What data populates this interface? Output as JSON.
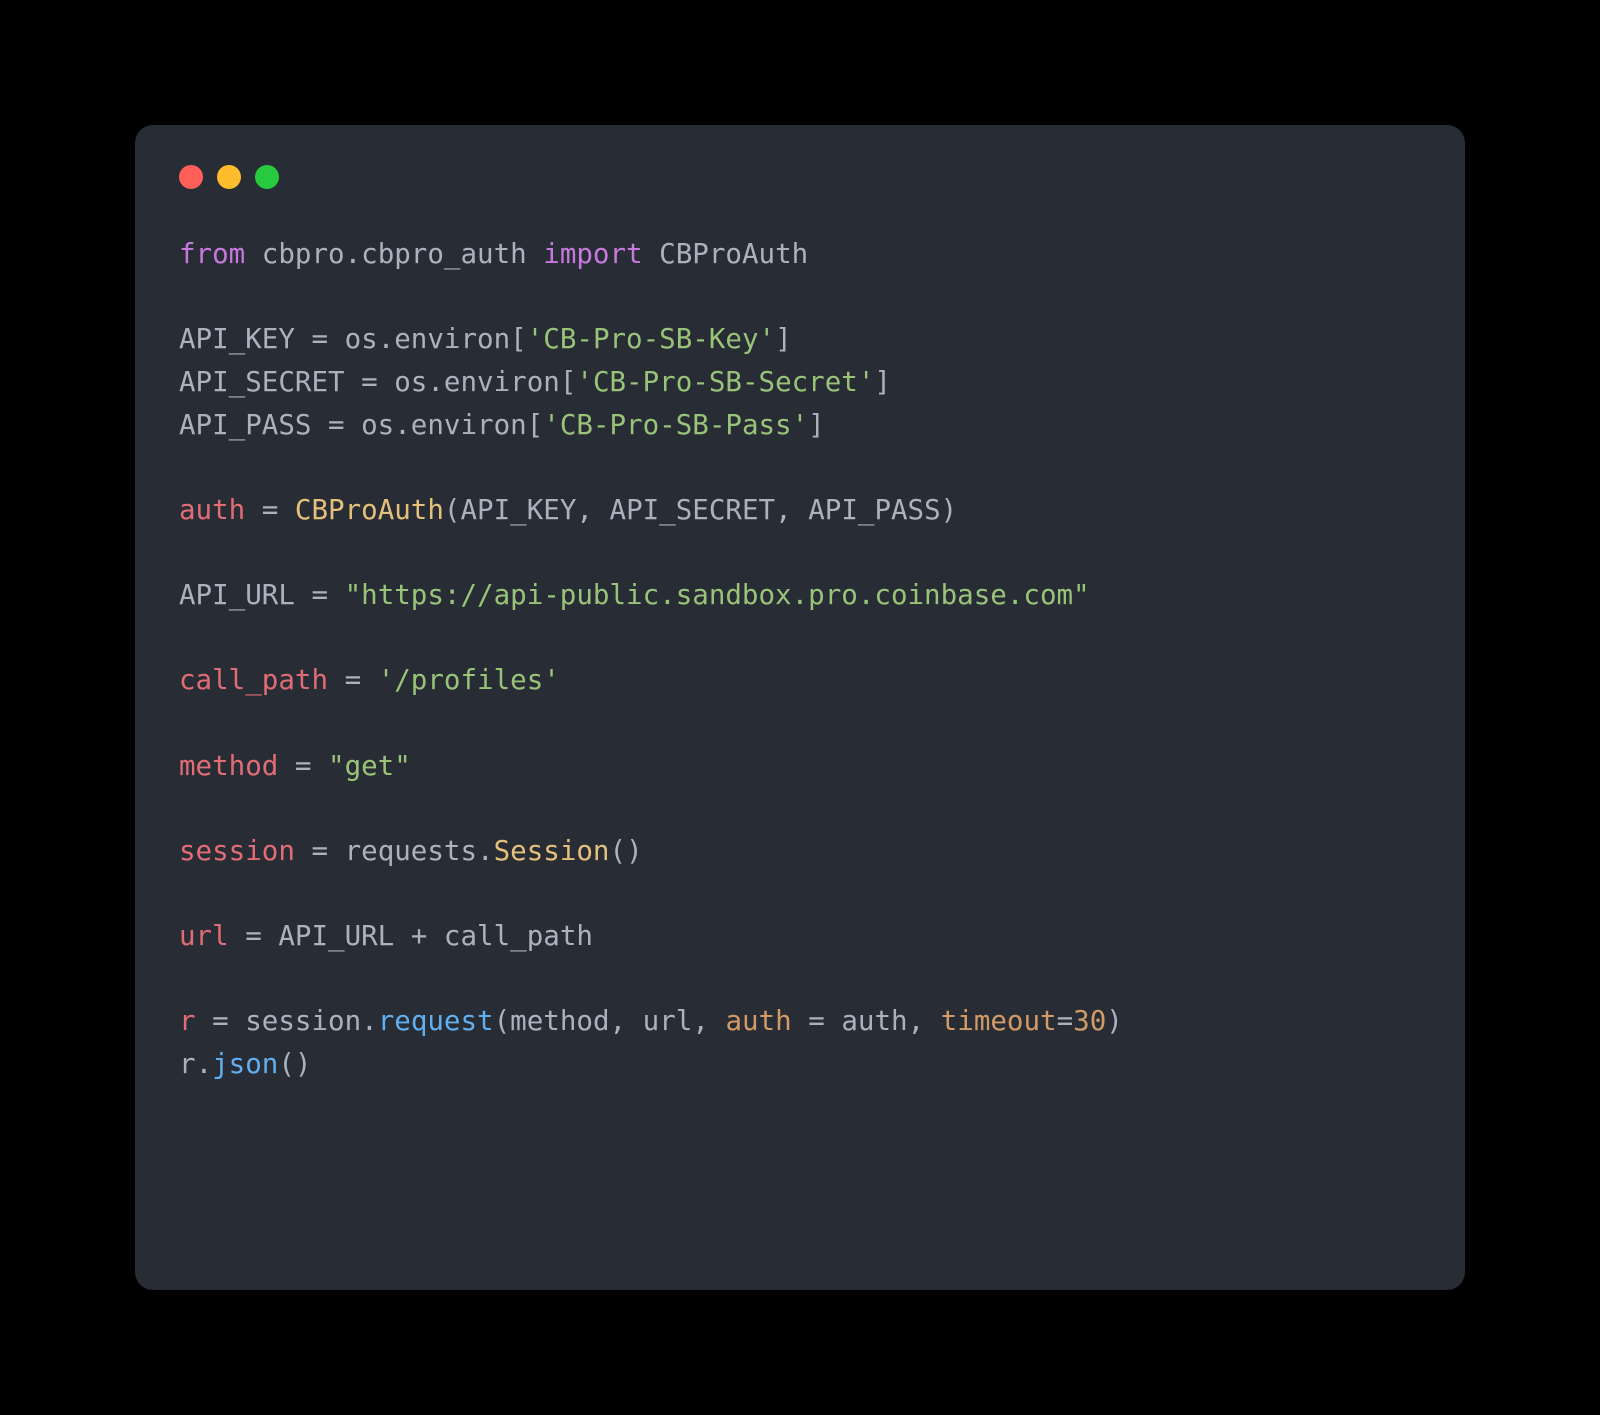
{
  "traffic_lights": {
    "red": "#ff5f56",
    "yellow": "#ffbd2e",
    "green": "#27c93f"
  },
  "theme": {
    "background": "#282c34",
    "text": "#abb2bf",
    "keyword": "#c678dd",
    "string": "#98c379",
    "number": "#d19a66",
    "function": "#61afef",
    "class": "#e5c07b",
    "variable": "#e06c75"
  },
  "code": {
    "kw_from": "from",
    "module_path": "cbpro.cbpro_auth",
    "kw_import": "import",
    "import_name": "CBProAuth",
    "api_key_var": "API_KEY",
    "api_secret_var": "API_SECRET",
    "api_pass_var": "API_PASS",
    "os_environ": "os.environ",
    "key_str": "'CB-Pro-SB-Key'",
    "secret_str": "'CB-Pro-SB-Secret'",
    "pass_str": "'CB-Pro-SB-Pass'",
    "auth_var": "auth",
    "cbproauth_cls": "CBProAuth",
    "api_url_var": "API_URL",
    "api_url_str": "\"https://api-public.sandbox.pro.coinbase.com\"",
    "call_path_var": "call_path",
    "call_path_str": "'/profiles'",
    "method_var": "method",
    "method_str": "\"get\"",
    "session_var": "session",
    "requests_mod": "requests",
    "session_cls": "Session",
    "url_var": "url",
    "r_var": "r",
    "request_fn": "request",
    "auth_kw": "auth",
    "timeout_kw": "timeout",
    "timeout_val": "30",
    "json_fn": "json",
    "eq": " = ",
    "plus": " + ",
    "comma": ", ",
    "dot": ".",
    "lpar": "(",
    "rpar": ")",
    "lbr": "[",
    "rbr": "]",
    "eq_tight": "="
  }
}
